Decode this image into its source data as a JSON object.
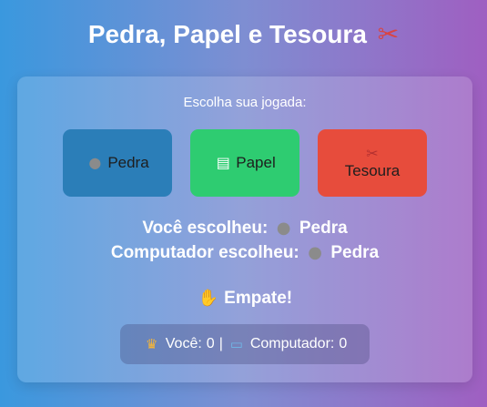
{
  "title": {
    "text": "Pedra, Papel e Tesoura",
    "icon": "scissors-icon"
  },
  "prompt": "Escolha sua jogada:",
  "choices": [
    {
      "label": "Pedra",
      "icon": "rock-icon",
      "color": "#2b7eb8"
    },
    {
      "label": "Papel",
      "icon": "paper-icon",
      "color": "#2ecc71"
    },
    {
      "label": "Tesoura",
      "icon": "scissors-icon",
      "color": "#e74c3c"
    }
  ],
  "result": {
    "player_label": "Você escolheu:",
    "player_choice": "Pedra",
    "computer_label": "Computador escolheu:",
    "computer_choice": "Pedra",
    "outcome": "Empate!"
  },
  "score": {
    "player_label": "Você:",
    "player_score": "0",
    "separator": "|",
    "computer_label": "Computador:",
    "computer_score": "0"
  }
}
